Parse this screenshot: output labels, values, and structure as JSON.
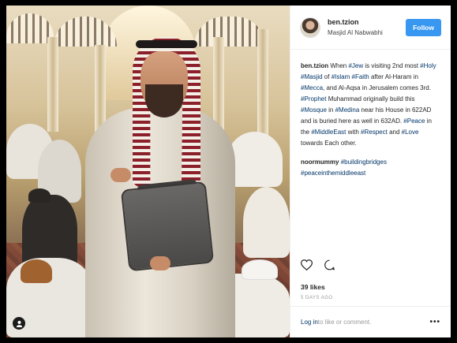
{
  "post": {
    "owner": {
      "username": "ben.tzion",
      "location": "Masjid Al Nabwabhi",
      "follow_label": "Follow"
    },
    "caption": [
      {
        "t": "ben.tzion",
        "k": "uname"
      },
      {
        "t": " When ",
        "k": "text"
      },
      {
        "t": "#Jew",
        "k": "tag"
      },
      {
        "t": " is visiting 2nd most ",
        "k": "text"
      },
      {
        "t": "#Holy",
        "k": "tag"
      },
      {
        "t": " ",
        "k": "text"
      },
      {
        "t": "#Masjid",
        "k": "tag"
      },
      {
        "t": " of ",
        "k": "text"
      },
      {
        "t": "#Islam",
        "k": "tag"
      },
      {
        "t": " ",
        "k": "text"
      },
      {
        "t": "#Faith",
        "k": "tag"
      },
      {
        "t": " after Al-Haram in ",
        "k": "text"
      },
      {
        "t": "#Mecca",
        "k": "tag"
      },
      {
        "t": ", and Al-Aqsa in Jerusalem comes 3rd. ",
        "k": "text"
      },
      {
        "t": "#Prophet",
        "k": "tag"
      },
      {
        "t": " Muhammad originally build this ",
        "k": "text"
      },
      {
        "t": "#Mosque",
        "k": "tag"
      },
      {
        "t": " in ",
        "k": "text"
      },
      {
        "t": "#Medina",
        "k": "tag"
      },
      {
        "t": " near his House in 622AD and is buried here as well in 632AD. ",
        "k": "text"
      },
      {
        "t": "#Peace",
        "k": "tag"
      },
      {
        "t": " in the ",
        "k": "text"
      },
      {
        "t": "#MiddleEast",
        "k": "tag"
      },
      {
        "t": " with ",
        "k": "text"
      },
      {
        "t": "#Respect",
        "k": "tag"
      },
      {
        "t": " and ",
        "k": "text"
      },
      {
        "t": "#Love",
        "k": "tag"
      },
      {
        "t": " towards Each other.",
        "k": "text"
      }
    ],
    "comment": {
      "username": "noormummy",
      "tags": [
        "#buildingbridges",
        "#peaceinthemiddleeast"
      ]
    },
    "likes": "39 likes",
    "time": "5 DAYS AGO",
    "footer": {
      "login_label": "Log in",
      "rest": " to like or comment.",
      "more_label": "•••"
    },
    "icons": {
      "like": "heart-icon",
      "comment": "comment-icon",
      "photo_badge": "user-tag-icon"
    }
  }
}
